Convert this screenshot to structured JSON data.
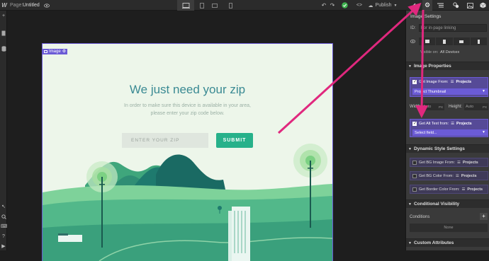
{
  "topbar": {
    "page_label": "Page:",
    "page_name": "Untitled",
    "publish_label": "Publish"
  },
  "canvas": {
    "image_tag_label": "Image",
    "title": "We just need your zip",
    "subtitle_line1": "In order to make sure this device is available in your area,",
    "subtitle_line2": "please enter your zip code below.",
    "zip_placeholder": "ENTER YOUR ZIP",
    "submit_label": "SUBMIT"
  },
  "panel": {
    "settings_title": "Image Settings",
    "id_label": "ID:",
    "id_placeholder": "For in-page linking",
    "visible_on_label": "Visible on:",
    "visible_on_value": "All Devices",
    "image_properties": "Image Properties",
    "get_image_from_label": "Get Image From:",
    "projects_label": "Projects",
    "image_field_value": "Project Thumbnail",
    "width_label": "Width",
    "auto_label": "Auto",
    "px_label": "PX",
    "height_label": "Height:",
    "get_alt_text_label": "Get Alt Text from:",
    "select_field_placeholder": "Select field...",
    "dynamic_style_settings": "Dynamic Style Settings",
    "get_bg_image_label": "Get BG Image From:",
    "get_bg_color_label": "Get BG Color From:",
    "get_border_color_label": "Get Border Color From:",
    "conditional_visibility": "Conditional Visibility",
    "conditions_label": "Conditions",
    "conditions_value": "None",
    "custom_attributes": "Custom Attributes"
  },
  "colors": {
    "accent_purple": "#6b5bd6",
    "submit_green": "#27b18a",
    "arrow_pink": "#e0287e",
    "publish_check_green": "#3fb24f"
  }
}
